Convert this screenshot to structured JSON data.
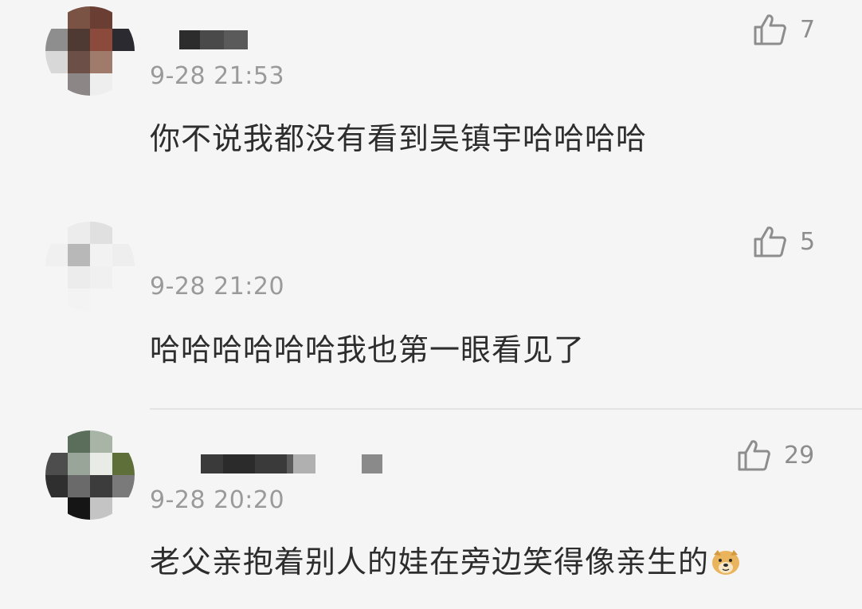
{
  "comments": [
    {
      "timestamp": "9-28 21:53",
      "content": "你不说我都没有看到吴镇宇哈哈哈哈",
      "likes": "7",
      "avatar_icon": "pixelated-avatar-icon"
    },
    {
      "timestamp": "9-28 21:20",
      "content": "哈哈哈哈哈哈我也第一眼看见了",
      "likes": "5",
      "avatar_icon": "pixelated-avatar-icon"
    },
    {
      "timestamp": "9-28 20:20",
      "content": "老父亲抱着别人的娃在旁边笑得像亲生的",
      "likes": "29",
      "avatar_icon": "pixelated-avatar-icon",
      "trailing_emoji": "doge-emoji-icon"
    }
  ],
  "like_icon": "thumbs-up-icon",
  "colors": {
    "background": "#f5f5f5",
    "text": "#2d2d2d",
    "muted": "#9a9a9a",
    "divider": "#e3e3e3"
  }
}
